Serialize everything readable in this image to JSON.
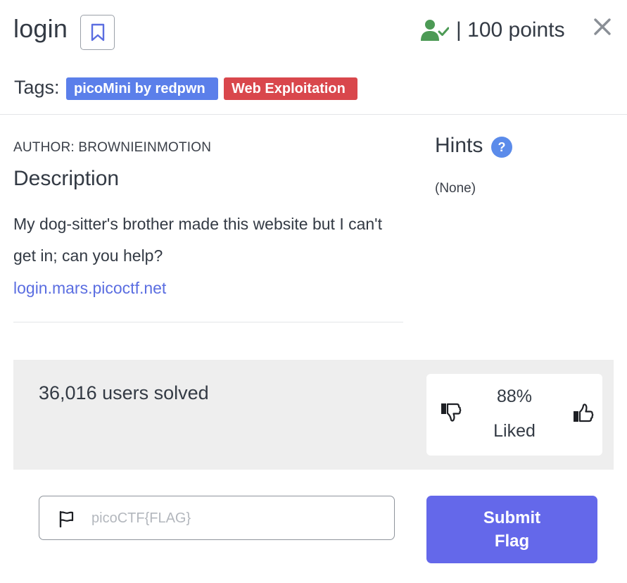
{
  "challenge": {
    "title": "login",
    "points": "| 100 points"
  },
  "tags": {
    "label": "Tags:",
    "items": [
      "picoMini by redpwn",
      "Web Exploitation"
    ]
  },
  "details": {
    "author": "AUTHOR: BROWNIEINMOTION",
    "heading": "Description",
    "text": "My dog-sitter's brother made this website but I can't get in; can you help?",
    "link": "login.mars.picoctf.net"
  },
  "hints": {
    "heading": "Hints",
    "help_glyph": "?",
    "content": "(None)"
  },
  "stats": {
    "solved": "36,016 users solved",
    "liked_percent": "88%",
    "liked_label": "Liked"
  },
  "flag": {
    "placeholder": "picoCTF{FLAG}",
    "submit_label": "Submit Flag"
  },
  "icons": {
    "bookmark": "bookmark-icon",
    "user_check": "user-check-icon",
    "close": "close-icon",
    "hint": "help-circle-icon",
    "thumb_down": "thumb-down-icon",
    "thumb_up": "thumb-up-icon",
    "flag": "flag-icon"
  },
  "colors": {
    "accent": "#6468ea",
    "tag_pico": "#5b7fea",
    "tag_web": "#d9474c",
    "link": "#5b6ee1",
    "solved_icon": "#4c9a55"
  }
}
